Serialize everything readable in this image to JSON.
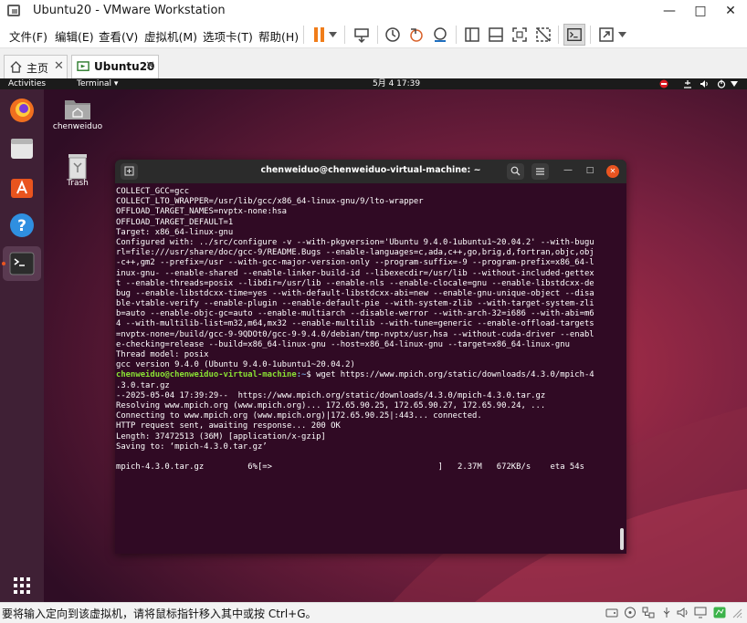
{
  "window": {
    "title": "Ubuntu20 - VMware Workstation"
  },
  "menu": {
    "items": [
      "文件(F)",
      "编辑(E)",
      "查看(V)",
      "虚拟机(M)",
      "选项卡(T)",
      "帮助(H)"
    ]
  },
  "tabs": {
    "home_label": "主页",
    "vm_label": "Ubuntu20"
  },
  "ubuntu": {
    "activities": "Activities",
    "app_menu": "Terminal ▾",
    "clock": "5月 4  17:39",
    "desktop_home": "chenweiduo",
    "desktop_trash": "Trash"
  },
  "terminal": {
    "title": "chenweiduo@chenweiduo-virtual-machine: ~",
    "lines_before": [
      "COLLECT_GCC=gcc",
      "COLLECT_LTO_WRAPPER=/usr/lib/gcc/x86_64-linux-gnu/9/lto-wrapper",
      "OFFLOAD_TARGET_NAMES=nvptx-none:hsa",
      "OFFLOAD_TARGET_DEFAULT=1",
      "Target: x86_64-linux-gnu",
      "Configured with: ../src/configure -v --with-pkgversion='Ubuntu 9.4.0-1ubuntu1~20.04.2' --with-bugu",
      "rl=file:///usr/share/doc/gcc-9/README.Bugs --enable-languages=c,ada,c++,go,brig,d,fortran,objc,obj",
      "-c++,gm2 --prefix=/usr --with-gcc-major-version-only --program-suffix=-9 --program-prefix=x86_64-l",
      "inux-gnu- --enable-shared --enable-linker-build-id --libexecdir=/usr/lib --without-included-gettex",
      "t --enable-threads=posix --libdir=/usr/lib --enable-nls --enable-clocale=gnu --enable-libstdcxx-de",
      "bug --enable-libstdcxx-time=yes --with-default-libstdcxx-abi=new --enable-gnu-unique-object --disa",
      "ble-vtable-verify --enable-plugin --enable-default-pie --with-system-zlib --with-target-system-zli",
      "b=auto --enable-objc-gc=auto --enable-multiarch --disable-werror --with-arch-32=i686 --with-abi=m6",
      "4 --with-multilib-list=m32,m64,mx32 --enable-multilib --with-tune=generic --enable-offload-targets",
      "=nvptx-none=/build/gcc-9-9QDOt0/gcc-9-9.4.0/debian/tmp-nvptx/usr,hsa --without-cuda-driver --enabl",
      "e-checking=release --build=x86_64-linux-gnu --host=x86_64-linux-gnu --target=x86_64-linux-gnu",
      "Thread model: posix",
      "gcc version 9.4.0 (Ubuntu 9.4.0-1ubuntu1~20.04.2)"
    ],
    "prompt_user": "chenweiduo@chenweiduo-virtual-machine",
    "prompt_path": ":~",
    "command": "$ wget https://www.mpich.org/static/downloads/4.3.0/mpich-4",
    "lines_after": [
      ".3.0.tar.gz",
      "--2025-05-04 17:39:29--  https://www.mpich.org/static/downloads/4.3.0/mpich-4.3.0.tar.gz",
      "Resolving www.mpich.org (www.mpich.org)... 172.65.90.25, 172.65.90.27, 172.65.90.24, ...",
      "Connecting to www.mpich.org (www.mpich.org)|172.65.90.25|:443... connected.",
      "HTTP request sent, awaiting response... 200 OK",
      "Length: 37472513 (36M) [application/x-gzip]",
      "Saving to: ‘mpich-4.3.0.tar.gz’",
      "",
      "mpich-4.3.0.tar.gz         6%[=>                                  ]   2.37M   672KB/s    eta 54s"
    ]
  },
  "status": {
    "message": "要将输入定向到该虚拟机，请将鼠标指针移入其中或按 Ctrl+G。"
  },
  "colors": {
    "desktop": "#5c1a3c",
    "terminal_bg": "#300a24",
    "prompt_user": "#8ae234",
    "prompt_path": "#729fcf",
    "pause_orange": "#f07d1a"
  }
}
